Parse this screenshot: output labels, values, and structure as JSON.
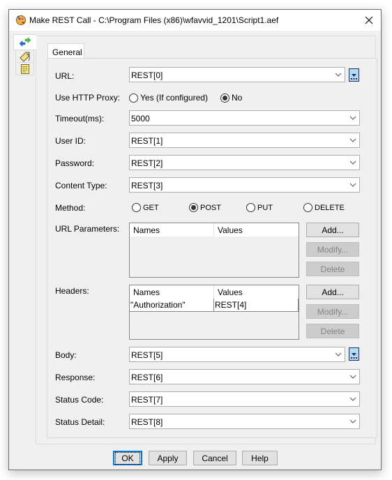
{
  "window": {
    "title": "Make REST Call - C:\\Program Files (x86)\\wfavvid_1201\\Script1.aef",
    "app_icon": "script-editor-icon",
    "close_icon": "close-icon"
  },
  "side_tabs": [
    {
      "icon": "arrows-exchange-icon",
      "active": true
    },
    {
      "icon": "tag-label-icon",
      "active": false
    },
    {
      "icon": "notepad-icon",
      "active": false
    }
  ],
  "tabs": [
    {
      "label": "General",
      "active": true
    }
  ],
  "form": {
    "url": {
      "label": "URL:",
      "value": "REST[0]"
    },
    "proxy": {
      "label": "Use HTTP Proxy:",
      "options": [
        {
          "label": "Yes (If configured)",
          "selected": false
        },
        {
          "label": "No",
          "selected": true
        }
      ]
    },
    "timeout": {
      "label": "Timeout(ms):",
      "value": "5000"
    },
    "user_id": {
      "label": "User ID:",
      "value": "REST[1]"
    },
    "password": {
      "label": "Password:",
      "value": "REST[2]"
    },
    "content_type": {
      "label": "Content Type:",
      "value": "REST[3]"
    },
    "method": {
      "label": "Method:",
      "options": [
        {
          "label": "GET",
          "selected": false
        },
        {
          "label": "POST",
          "selected": true
        },
        {
          "label": "PUT",
          "selected": false
        },
        {
          "label": "DELETE",
          "selected": false
        }
      ]
    },
    "url_parameters": {
      "label": "URL Parameters:",
      "columns": [
        "Names",
        "Values"
      ],
      "rows": [],
      "buttons": {
        "add": "Add...",
        "modify": "Modify...",
        "delete": "Delete"
      }
    },
    "headers": {
      "label": "Headers:",
      "columns": [
        "Names",
        "Values"
      ],
      "rows": [
        {
          "name": "\"Authorization\"",
          "value": "REST[4]"
        }
      ],
      "buttons": {
        "add": "Add...",
        "modify": "Modify...",
        "delete": "Delete"
      }
    },
    "body": {
      "label": "Body:",
      "value": "REST[5]"
    },
    "response": {
      "label": "Response:",
      "value": "REST[6]"
    },
    "status_code": {
      "label": "Status Code:",
      "value": "REST[7]"
    },
    "status_detail": {
      "label": "Status Detail:",
      "value": "REST[8]"
    }
  },
  "footer": {
    "ok": "OK",
    "apply": "Apply",
    "cancel": "Cancel",
    "help": "Help"
  },
  "colors": {
    "focus_blue": "#0078d7",
    "dots_button_fill": "#b4dcee",
    "dots_button_border": "#1e2b6f"
  }
}
